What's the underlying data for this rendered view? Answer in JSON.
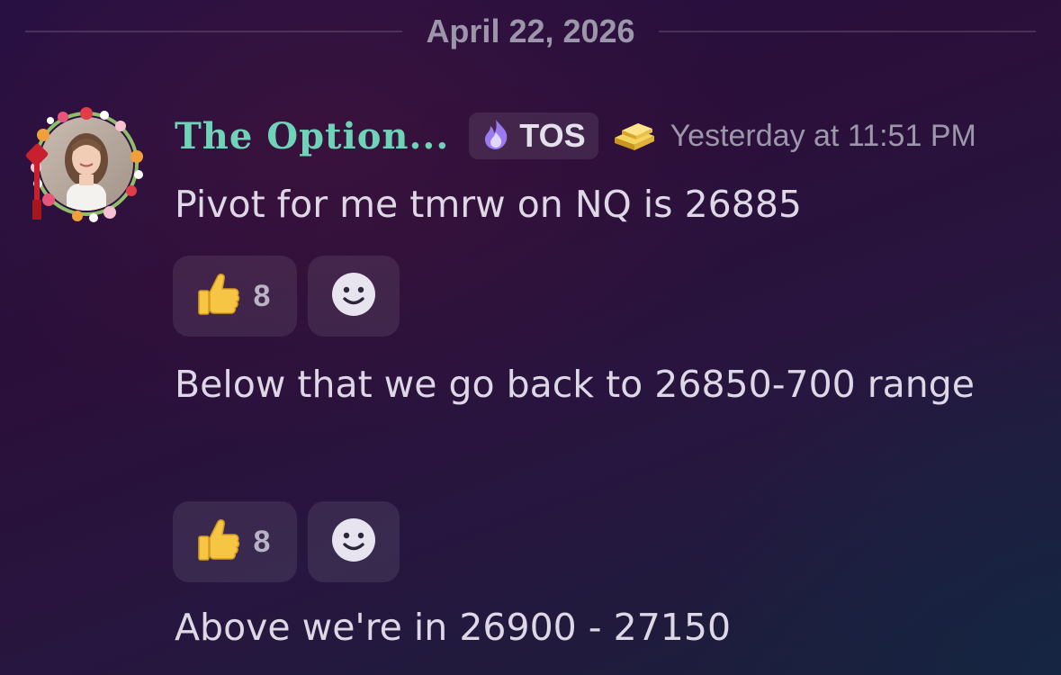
{
  "date_divider": "April 22, 2026",
  "message": {
    "username": "The Option...",
    "role_tag": "TOS",
    "timestamp": "Yesterday at 11:51 PM",
    "lines": [
      "Pivot for me tmrw on NQ is 26885",
      "Below that we go back to 26850-700 range",
      "Above we're in 26900 - 27150"
    ],
    "reactions": [
      {
        "emoji": "thumbs-up",
        "count": "8"
      },
      {
        "emoji": "thumbs-up",
        "count": "8"
      }
    ]
  },
  "icons": {
    "role": "purple-flame-icon",
    "badge": "gold-bars-icon",
    "add_reaction": "add-reaction-smiley-icon"
  },
  "colors": {
    "username": "#6fd3b8",
    "timestamp": "#9d97ab",
    "text": "#ddd7e6"
  }
}
